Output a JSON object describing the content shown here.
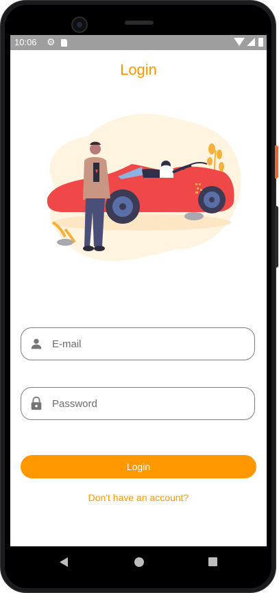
{
  "status_bar": {
    "time": "10:06",
    "icons": [
      "settings-icon",
      "sd-card-icon",
      "wifi-icon",
      "signal-icon",
      "battery-icon"
    ]
  },
  "header": {
    "title": "Login"
  },
  "illustration": {
    "description_icon": "car-illustration"
  },
  "form": {
    "email": {
      "placeholder": "E-mail",
      "value": "",
      "icon": "person-icon"
    },
    "password": {
      "placeholder": "Password",
      "value": "",
      "icon": "lock-icon"
    },
    "login_button_label": "Login",
    "signup_link_label": "Don't have an account?"
  },
  "nav_bar": {
    "buttons": [
      "back-icon",
      "home-icon",
      "recents-icon"
    ]
  },
  "colors": {
    "accent": "#ff9800",
    "status_bar": "#9e9e9e",
    "field_border": "#7d7d7d",
    "car": "#f04848"
  }
}
